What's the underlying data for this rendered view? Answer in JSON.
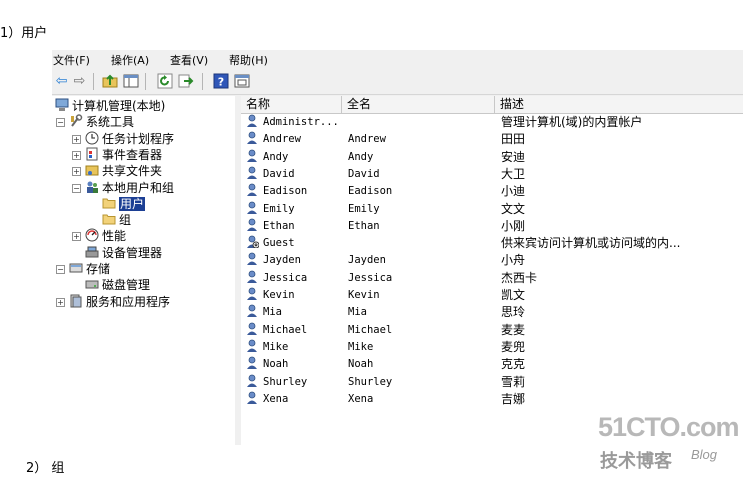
{
  "captions": {
    "c1": "1）用户",
    "c2": "2） 组"
  },
  "menu": [
    "文件(F)",
    "操作(A)",
    "查看(V)",
    "帮助(H)"
  ],
  "toolbar": [
    "back-icon",
    "forward-icon",
    "up-folder-icon",
    "console-tree-icon",
    "refresh-icon",
    "export-list-icon",
    "help-icon",
    "properties-icon"
  ],
  "tree": [
    {
      "label": "计算机管理(本地)",
      "icon": "computer-icon",
      "level": 0,
      "expander": ""
    },
    {
      "label": "系统工具",
      "icon": "tools-icon",
      "level": 1,
      "expander": "−"
    },
    {
      "label": "任务计划程序",
      "icon": "clock-icon",
      "level": 2,
      "expander": "+"
    },
    {
      "label": "事件查看器",
      "icon": "event-viewer-icon",
      "level": 2,
      "expander": "+"
    },
    {
      "label": "共享文件夹",
      "icon": "shared-folder-icon",
      "level": 2,
      "expander": "+"
    },
    {
      "label": "本地用户和组",
      "icon": "users-group-icon",
      "level": 2,
      "expander": "−"
    },
    {
      "label": "用户",
      "icon": "folder-icon",
      "level": 3,
      "expander": "",
      "selected": true
    },
    {
      "label": "组",
      "icon": "folder-icon",
      "level": 3,
      "expander": ""
    },
    {
      "label": "性能",
      "icon": "performance-icon",
      "level": 2,
      "expander": "+"
    },
    {
      "label": "设备管理器",
      "icon": "device-manager-icon",
      "level": 2,
      "expander": ""
    },
    {
      "label": "存储",
      "icon": "storage-icon",
      "level": 1,
      "expander": "−"
    },
    {
      "label": "磁盘管理",
      "icon": "disk-icon",
      "level": 2,
      "expander": ""
    },
    {
      "label": "服务和应用程序",
      "icon": "services-icon",
      "level": 1,
      "expander": "+"
    }
  ],
  "columns": {
    "name": "名称",
    "fullname": "全名",
    "desc": "描述"
  },
  "users": [
    {
      "name": "Administr...",
      "fullname": "",
      "desc": "管理计算机(域)的内置帐户"
    },
    {
      "name": "Andrew",
      "fullname": "Andrew",
      "desc": "田田"
    },
    {
      "name": "Andy",
      "fullname": "Andy",
      "desc": "安迪"
    },
    {
      "name": "David",
      "fullname": "David",
      "desc": "大卫"
    },
    {
      "name": "Eadison",
      "fullname": "Eadison",
      "desc": "小迪"
    },
    {
      "name": "Emily",
      "fullname": "Emily",
      "desc": "文文"
    },
    {
      "name": "Ethan",
      "fullname": "Ethan",
      "desc": "小刚"
    },
    {
      "name": "Guest",
      "fullname": "",
      "desc": "供来宾访问计算机或访问域的内...",
      "disabled": true
    },
    {
      "name": "Jayden",
      "fullname": "Jayden",
      "desc": "小舟"
    },
    {
      "name": "Jessica",
      "fullname": "Jessica",
      "desc": "杰西卡"
    },
    {
      "name": "Kevin",
      "fullname": "Kevin",
      "desc": "凯文"
    },
    {
      "name": "Mia",
      "fullname": "Mia",
      "desc": "思玲"
    },
    {
      "name": "Michael",
      "fullname": "Michael",
      "desc": "麦麦"
    },
    {
      "name": "Mike",
      "fullname": "Mike",
      "desc": "麦兜"
    },
    {
      "name": "Noah",
      "fullname": "Noah",
      "desc": "克克"
    },
    {
      "name": "Shurley",
      "fullname": "Shurley",
      "desc": "雪莉"
    },
    {
      "name": "Xena",
      "fullname": "Xena",
      "desc": "吉娜"
    }
  ],
  "watermark": {
    "main": "51CTO.com",
    "sub": "技术博客",
    "tag": "Blog"
  }
}
